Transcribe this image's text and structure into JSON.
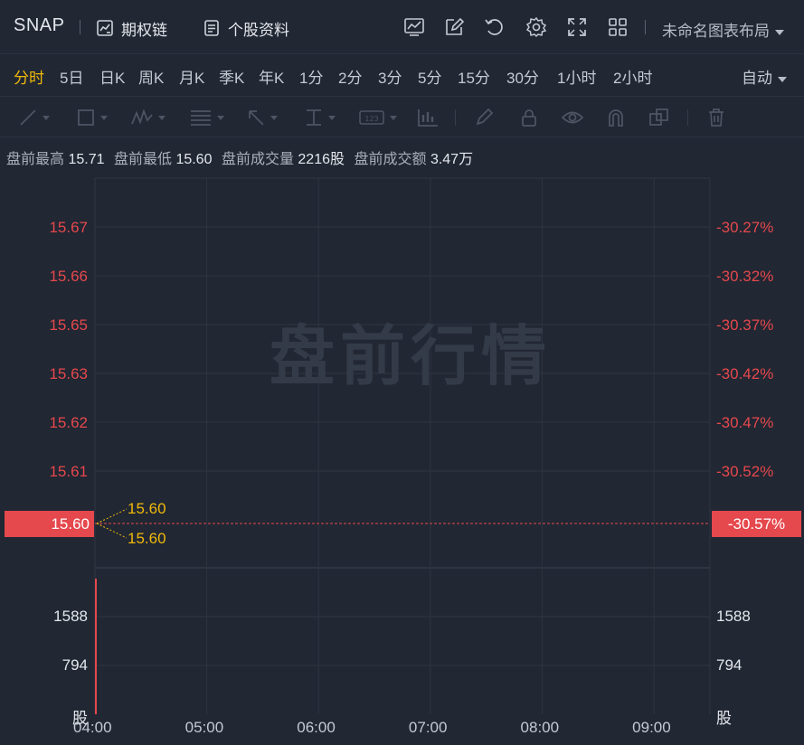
{
  "header": {
    "ticker": "SNAP",
    "options_chain": "期权链",
    "stock_profile": "个股资料",
    "layout_name": "未命名图表布局"
  },
  "periods": [
    {
      "label": "分时",
      "active": true
    },
    {
      "label": "5日"
    },
    {
      "label": "日K"
    },
    {
      "label": "周K"
    },
    {
      "label": "月K"
    },
    {
      "label": "季K"
    },
    {
      "label": "年K"
    },
    {
      "label": "1分"
    },
    {
      "label": "2分"
    },
    {
      "label": "3分"
    },
    {
      "label": "5分"
    },
    {
      "label": "15分"
    },
    {
      "label": "30分"
    },
    {
      "label": "1小时"
    },
    {
      "label": "2小时"
    }
  ],
  "auto_label": "自动",
  "info": {
    "high_label": "盘前最高",
    "high_value": "15.71",
    "low_label": "盘前最低",
    "low_value": "15.60",
    "volume_label": "盘前成交量",
    "volume_value": "2216股",
    "amount_label": "盘前成交额",
    "amount_value": "3.47万"
  },
  "watermark": "盘前行情",
  "colors": {
    "up_red": "#e5484d",
    "accent_yellow": "#f0b90b",
    "grid": "#2e3541",
    "bg": "#212733"
  },
  "chart_data": {
    "type": "line",
    "price_axis_left": [
      "15.67",
      "15.66",
      "15.65",
      "15.63",
      "15.62",
      "15.61"
    ],
    "price_axis_right": [
      "-30.27%",
      "-30.32%",
      "-30.37%",
      "-30.42%",
      "-30.47%",
      "-30.52%"
    ],
    "current_price": "15.60",
    "current_change": "-30.57%",
    "high_marker": "15.60",
    "low_marker": "15.60",
    "x_ticks": [
      "04:00",
      "05:00",
      "06:00",
      "07:00",
      "08:00",
      "09:00"
    ],
    "volume_axis_left": [
      "1588",
      "794",
      "股"
    ],
    "volume_axis_right": [
      "1588",
      "794",
      "股"
    ],
    "volume_bars": [
      {
        "time": "04:00",
        "volume": 2216
      }
    ],
    "volume_ylim": [
      0,
      2216
    ]
  }
}
